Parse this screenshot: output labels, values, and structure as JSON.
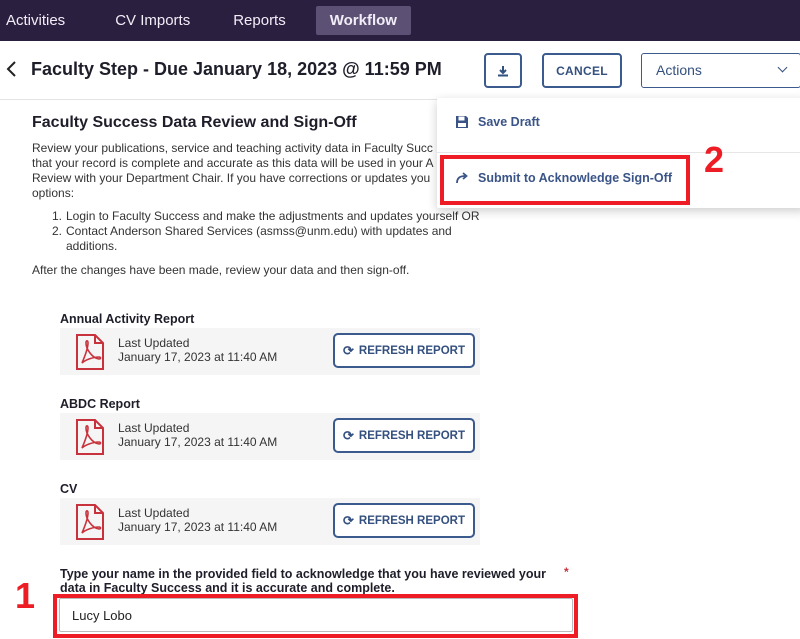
{
  "nav": {
    "tabs": [
      {
        "label": "Activities",
        "active": false
      },
      {
        "label": "CV Imports",
        "active": false
      },
      {
        "label": "Reports",
        "active": false
      },
      {
        "label": "Workflow",
        "active": true
      }
    ]
  },
  "header": {
    "title": "Faculty Step - Due January 18, 2023 @ 11:59 PM",
    "cancel_label": "CANCEL",
    "actions_label": "Actions"
  },
  "actions_menu": {
    "items": [
      {
        "label": "Save Draft",
        "icon": "save-icon"
      },
      {
        "label": "Submit to Acknowledge Sign-Off",
        "icon": "share-arrow-icon"
      }
    ]
  },
  "content": {
    "section_title": "Faculty Success Data Review and Sign-Off",
    "intro_lines": [
      "Review your publications, service and teaching activity data in Faculty Succ",
      "that your record is complete and accurate as this data will be used in your A",
      "Review with your Department Chair. If you have corrections or updates you",
      "options:"
    ],
    "steps": [
      {
        "num": "1.",
        "lines": [
          "Login to Faculty Success and make the adjustments and updates yourself OR"
        ]
      },
      {
        "num": "2.",
        "lines": [
          "Contact Anderson Shared Services (asmss@unm.edu) with updates and",
          "additions."
        ]
      }
    ],
    "after_text": "After the changes have been made, review your data and then sign-off."
  },
  "reports": [
    {
      "title": "Annual Activity Report",
      "last_updated_label": "Last Updated",
      "last_updated": "January 17, 2023 at 11:40 AM",
      "refresh_label": "REFRESH REPORT"
    },
    {
      "title": "ABDC Report",
      "last_updated_label": "Last Updated",
      "last_updated": "January 17, 2023 at 11:40 AM",
      "refresh_label": "REFRESH REPORT"
    },
    {
      "title": "CV",
      "last_updated_label": "Last Updated",
      "last_updated": "January 17, 2023 at 11:40 AM",
      "refresh_label": "REFRESH REPORT"
    }
  ],
  "acknowledge": {
    "label_lines": [
      "Type your name in the provided field to acknowledge that you have reviewed your",
      "data in Faculty Success and it is accurate and complete."
    ],
    "required_mark": "*",
    "value": "Lucy Lobo"
  },
  "annotations": {
    "step1": "1",
    "step2": "2",
    "color": "#ee1c24"
  },
  "colors": {
    "nav_bg": "#2b1f3f",
    "accent": "#34507f",
    "pdf_red": "#c8323c"
  }
}
